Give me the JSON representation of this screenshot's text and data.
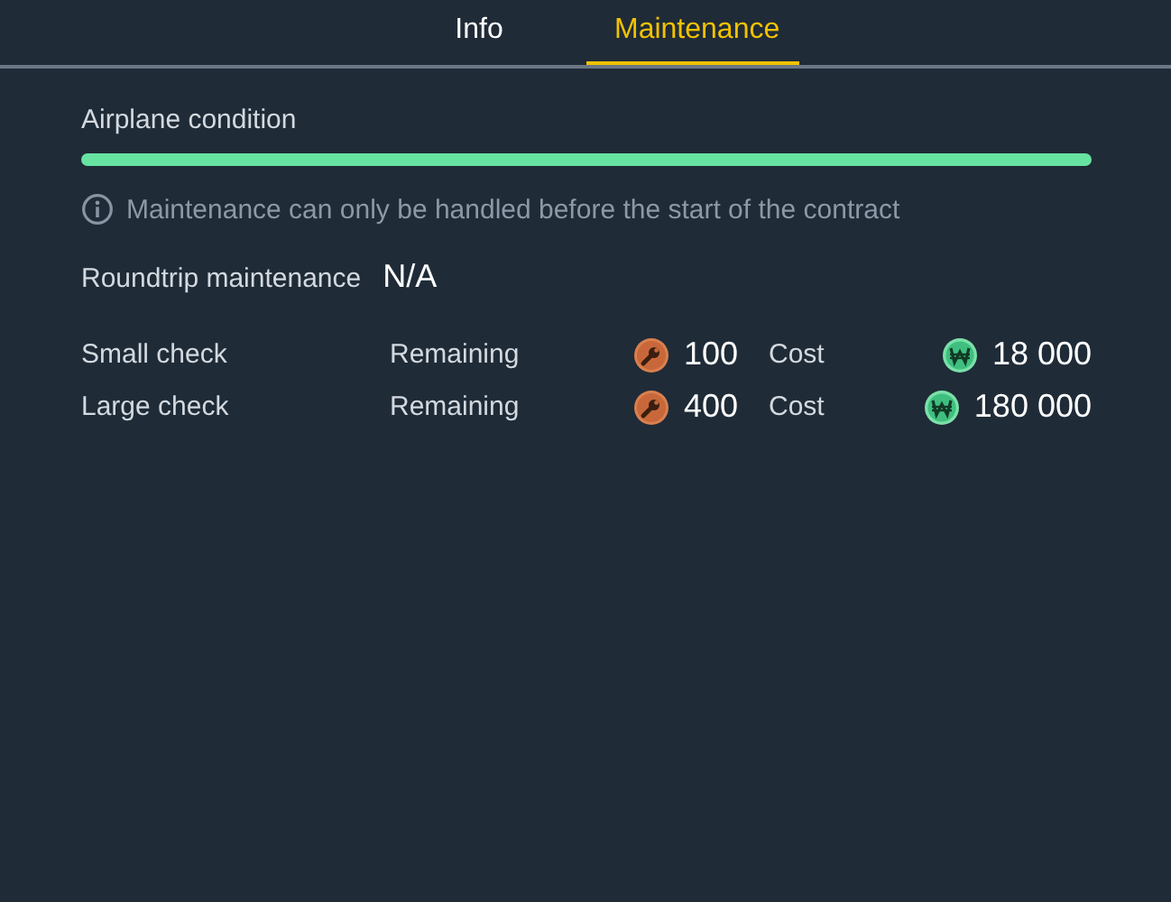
{
  "tabs": [
    {
      "label": "Info",
      "selected": false
    },
    {
      "label": "Maintenance",
      "selected": true
    }
  ],
  "condition": {
    "label": "Airplane condition",
    "level": 1
  },
  "notice": "Maintenance can only be handled before the start of the contract",
  "roundtrip": {
    "label": "Roundtrip maintenance",
    "value": "N/A"
  },
  "checks": [
    {
      "name": "Small check",
      "remaining_label": "Remaining",
      "remaining": "100",
      "cost_label": "Cost",
      "cost": "18 000"
    },
    {
      "name": "Large check",
      "remaining_label": "Remaining",
      "remaining": "400",
      "cost_label": "Cost",
      "cost": "180 000"
    }
  ]
}
